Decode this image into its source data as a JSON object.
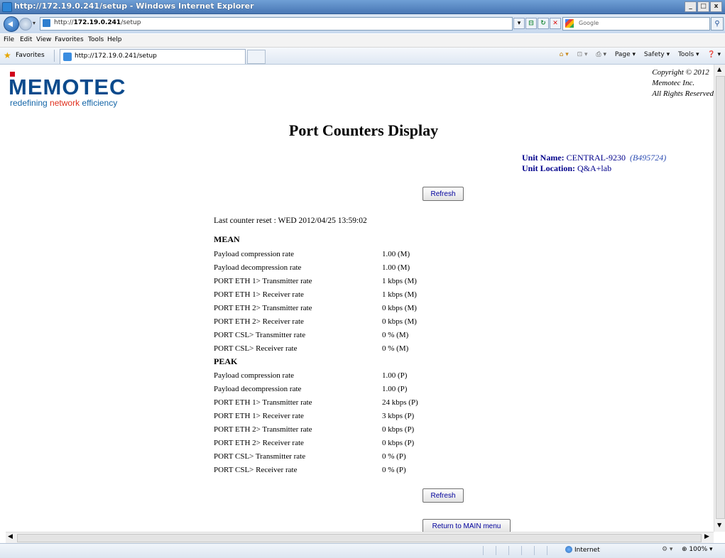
{
  "window": {
    "title": "http://172.19.0.241/setup - Windows Internet Explorer",
    "min": "_",
    "max": "□",
    "close": "x"
  },
  "address": {
    "url_prefix": "http://",
    "url_host": "172.19.0.241",
    "url_path": "/setup"
  },
  "search": {
    "placeholder": "Google"
  },
  "menu": [
    "File",
    "Edit",
    "View",
    "Favorites",
    "Tools",
    "Help"
  ],
  "favorites": {
    "label": "Favorites",
    "tab_title": "http://172.19.0.241/setup"
  },
  "command_bar": {
    "page": "Page ▾",
    "safety": "Safety ▾",
    "tools": "Tools ▾",
    "help": "❓ ▾"
  },
  "brand": {
    "name": "MEMOTEC",
    "tag_prefix": "redefining ",
    "tag_highlight": "network",
    "tag_suffix": " efficiency"
  },
  "copyright": {
    "line1": "Copyright © 2012",
    "line2": "Memotec Inc.",
    "line3": "All Rights Reserved"
  },
  "page_title": "Port Counters Display",
  "unit": {
    "name_label": "Unit Name:",
    "name_value": "CENTRAL-9230",
    "serial": "(B495724)",
    "location_label": "Unit Location:",
    "location_value": "Q&A+lab"
  },
  "buttons": {
    "refresh": "Refresh",
    "return_main": "Return to MAIN menu"
  },
  "last_reset": "Last counter reset : WED 2012/04/25 13:59:02",
  "mean": {
    "heading": "MEAN",
    "rows": [
      {
        "label": "Payload compression rate",
        "value": "1.00 (M)"
      },
      {
        "label": "Payload decompression rate",
        "value": "1.00 (M)"
      },
      {
        "label": "PORT ETH 1> Transmitter rate",
        "value": "1 kbps (M)"
      },
      {
        "label": "PORT ETH 1> Receiver rate",
        "value": "1 kbps (M)"
      },
      {
        "label": "PORT ETH 2> Transmitter rate",
        "value": "0 kbps (M)"
      },
      {
        "label": "PORT ETH 2> Receiver rate",
        "value": "0 kbps (M)"
      },
      {
        "label": "PORT CSL> Transmitter rate",
        "value": "0 % (M)"
      },
      {
        "label": "PORT CSL> Receiver rate",
        "value": "0 % (M)"
      }
    ]
  },
  "peak": {
    "heading": "PEAK",
    "rows": [
      {
        "label": "Payload compression rate",
        "value": "1.00 (P)"
      },
      {
        "label": "Payload decompression rate",
        "value": "1.00 (P)"
      },
      {
        "label": "PORT ETH 1> Transmitter rate",
        "value": "24 kbps (P)"
      },
      {
        "label": "PORT ETH 1> Receiver rate",
        "value": "3 kbps (P)"
      },
      {
        "label": "PORT ETH 2> Transmitter rate",
        "value": "0 kbps (P)"
      },
      {
        "label": "PORT ETH 2> Receiver rate",
        "value": "0 kbps (P)"
      },
      {
        "label": "PORT CSL> Transmitter rate",
        "value": "0 % (P)"
      },
      {
        "label": "PORT CSL> Receiver rate",
        "value": "0 % (P)"
      }
    ]
  },
  "status": {
    "zone": "Internet",
    "zoom": "100%"
  },
  "colors": {
    "brand_blue": "#0b4a8c",
    "brand_red": "#d0021b",
    "link_navy": "#00008b"
  }
}
